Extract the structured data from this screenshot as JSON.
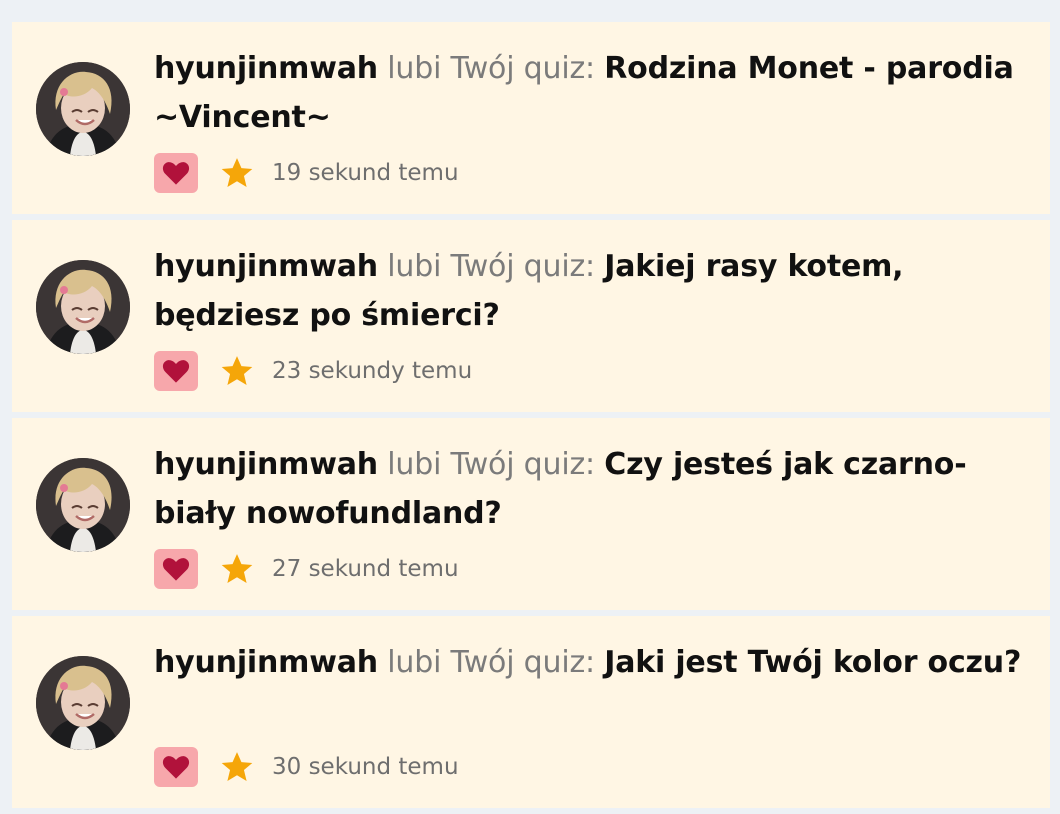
{
  "colors": {
    "page_background": "#edf1f5",
    "card_background": "#fff6e4",
    "like_button_bg": "#f7a7ab",
    "heart": "#b1123b",
    "star": "#f5a609",
    "muted_text": "#7b7b7b"
  },
  "icons": {
    "like": "heart-icon",
    "favorite": "star-icon"
  },
  "notifications": [
    {
      "user": "hyunjinmwah",
      "verb": "lubi Twój quiz:",
      "quiz": "Rodzina Monet - parodia ~Vincent~",
      "time": "19 sekund temu"
    },
    {
      "user": "hyunjinmwah",
      "verb": "lubi Twój quiz:",
      "quiz": "Jakiej rasy kotem, będziesz po śmierci?",
      "time": "23 sekundy temu"
    },
    {
      "user": "hyunjinmwah",
      "verb": "lubi Twój quiz:",
      "quiz": "Czy jesteś jak czarno-biały nowofundland?",
      "time": "27 sekund temu"
    },
    {
      "user": "hyunjinmwah",
      "verb": "lubi Twój quiz:",
      "quiz": "Jaki jest Twój kolor oczu?",
      "time": "30 sekund temu"
    }
  ]
}
